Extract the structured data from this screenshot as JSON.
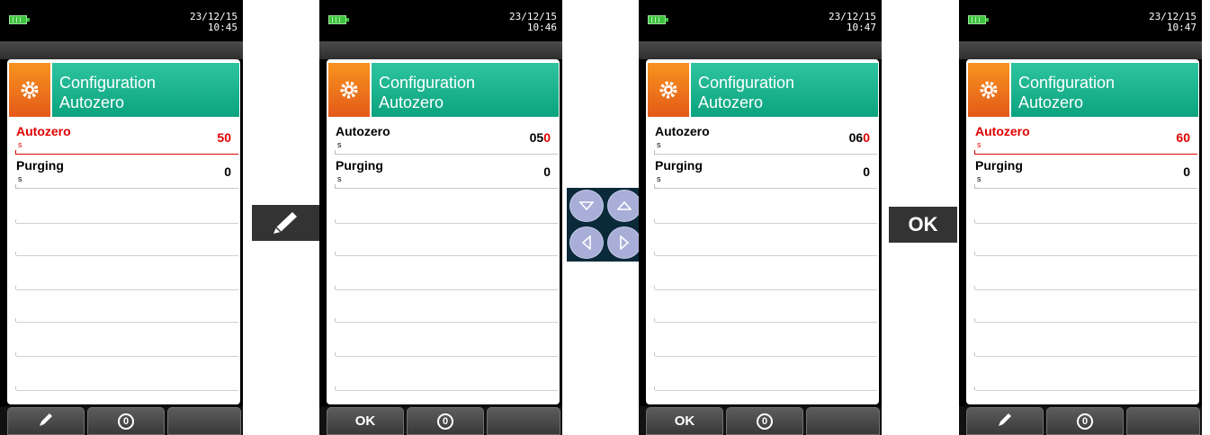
{
  "screens": [
    {
      "date": "23/12/15",
      "time": "10:45",
      "title_line1": "Configuration",
      "title_line2": "Autozero",
      "rows": [
        {
          "label": "Autozero",
          "unit": "s",
          "value": "50",
          "selected": true
        },
        {
          "label": "Purging",
          "unit": "s",
          "value": "0",
          "selected": false
        }
      ],
      "softkeys": [
        "pencil-icon",
        "zero-icon",
        ""
      ]
    },
    {
      "date": "23/12/15",
      "time": "10:46",
      "title_line1": "Configuration",
      "title_line2": "Autozero",
      "rows": [
        {
          "label": "Autozero",
          "unit": "s",
          "value_prefix": "05",
          "value_cursor": "0",
          "selected": false
        },
        {
          "label": "Purging",
          "unit": "s",
          "value": "0",
          "selected": false
        }
      ],
      "softkeys": [
        "OK",
        "zero-icon",
        ""
      ]
    },
    {
      "date": "23/12/15",
      "time": "10:47",
      "title_line1": "Configuration",
      "title_line2": "Autozero",
      "rows": [
        {
          "label": "Autozero",
          "unit": "s",
          "value_prefix": "06",
          "value_cursor": "0",
          "selected": false
        },
        {
          "label": "Purging",
          "unit": "s",
          "value": "0",
          "selected": false
        }
      ],
      "softkeys": [
        "OK",
        "zero-icon",
        ""
      ]
    },
    {
      "date": "23/12/15",
      "time": "10:47",
      "title_line1": "Configuration",
      "title_line2": "Autozero",
      "rows": [
        {
          "label": "Autozero",
          "unit": "s",
          "value": "60",
          "selected": true
        },
        {
          "label": "Purging",
          "unit": "s",
          "value": "0",
          "selected": false
        }
      ],
      "softkeys": [
        "pencil-icon",
        "zero-icon",
        ""
      ]
    }
  ],
  "zero_symbol": "0",
  "ok_key": "OK",
  "colors": {
    "accent_red": "#e00000",
    "header_teal": "#12a784",
    "header_orange": "#f07d1c"
  }
}
